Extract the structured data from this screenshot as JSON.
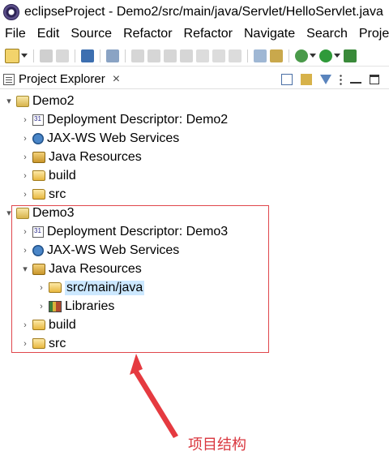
{
  "window": {
    "title": "eclipseProject - Demo2/src/main/java/Servlet/HelloServlet.java"
  },
  "menubar": [
    "File",
    "Edit",
    "Source",
    "Refactor",
    "Refactor",
    "Navigate",
    "Search",
    "Project"
  ],
  "view": {
    "tab_label": "Project Explorer",
    "close_glyph": "×"
  },
  "tree": [
    {
      "label": "Demo2",
      "depth": 0,
      "expanded": true,
      "icon": "web-project-icon"
    },
    {
      "label": "Deployment Descriptor: Demo2",
      "depth": 1,
      "expanded": false,
      "icon": "deployment-descriptor-icon"
    },
    {
      "label": "JAX-WS Web Services",
      "depth": 1,
      "expanded": false,
      "icon": "web-services-icon"
    },
    {
      "label": "Java Resources",
      "depth": 1,
      "expanded": false,
      "icon": "java-resources-icon"
    },
    {
      "label": "build",
      "depth": 1,
      "expanded": false,
      "icon": "folder-icon"
    },
    {
      "label": "src",
      "depth": 1,
      "expanded": false,
      "icon": "folder-icon"
    },
    {
      "label": "Demo3",
      "depth": 0,
      "expanded": true,
      "icon": "web-project-icon"
    },
    {
      "label": "Deployment Descriptor: Demo3",
      "depth": 1,
      "expanded": false,
      "icon": "deployment-descriptor-icon"
    },
    {
      "label": "JAX-WS Web Services",
      "depth": 1,
      "expanded": false,
      "icon": "web-services-icon"
    },
    {
      "label": "Java Resources",
      "depth": 1,
      "expanded": true,
      "icon": "java-resources-icon"
    },
    {
      "label": "src/main/java",
      "depth": 2,
      "expanded": false,
      "icon": "source-folder-icon",
      "selected": true
    },
    {
      "label": "Libraries",
      "depth": 2,
      "expanded": false,
      "icon": "libraries-icon"
    },
    {
      "label": "build",
      "depth": 1,
      "expanded": false,
      "icon": "folder-icon"
    },
    {
      "label": "src",
      "depth": 1,
      "expanded": false,
      "icon": "folder-icon"
    }
  ],
  "annotation": {
    "label": "项目结构",
    "color": "#d9363e"
  },
  "colors": {
    "selection": "#cce8ff",
    "annotation_box": "#e0474c"
  }
}
